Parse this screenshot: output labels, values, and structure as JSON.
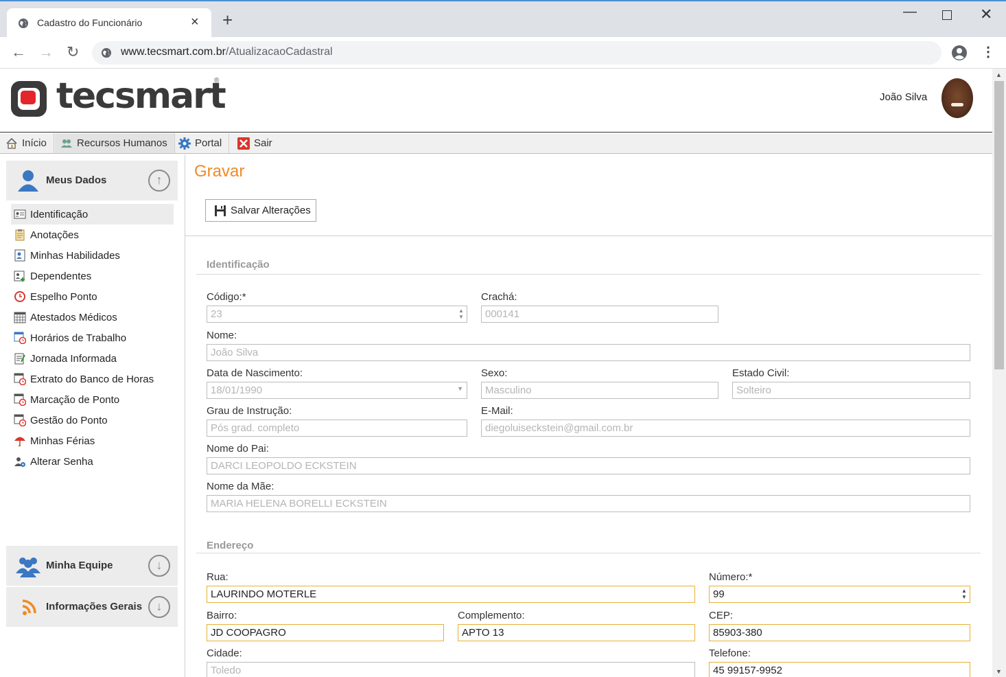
{
  "browser": {
    "tab_title": "Cadastro do Funcionário",
    "url_host": "www.tecsmart.com.br",
    "url_path": "/AtualizacaoCadastral"
  },
  "header": {
    "logo_text": "tecsmart",
    "logo_reg": "®",
    "user_name": "João Silva"
  },
  "menu": {
    "items": [
      {
        "label": "Início",
        "icon": "home-icon"
      },
      {
        "label": "Recursos Humanos",
        "icon": "people-icon"
      },
      {
        "label": "Portal",
        "icon": "gear-icon"
      },
      {
        "label": "Sair",
        "icon": "exit-icon"
      }
    ]
  },
  "sidebar": {
    "meus_dados": "Meus Dados",
    "items": [
      {
        "label": "Identificação"
      },
      {
        "label": "Anotações"
      },
      {
        "label": "Minhas Habilidades"
      },
      {
        "label": "Dependentes"
      },
      {
        "label": "Espelho Ponto"
      },
      {
        "label": "Atestados Médicos"
      },
      {
        "label": "Horários de Trabalho"
      },
      {
        "label": "Jornada Informada"
      },
      {
        "label": "Extrato do Banco de Horas"
      },
      {
        "label": "Marcação de Ponto"
      },
      {
        "label": "Gestão do Ponto"
      },
      {
        "label": "Minhas Férias"
      },
      {
        "label": "Alterar Senha"
      }
    ],
    "minha_equipe": "Minha Equipe",
    "informacoes_gerais": "Informações Gerais"
  },
  "content": {
    "title": "Gravar",
    "save_label": "Salvar Alterações",
    "identificacao": {
      "section": "Identificação",
      "codigo_label": "Código:*",
      "codigo_value": "23",
      "cracha_label": "Crachá:",
      "cracha_value": "000141",
      "nome_label": "Nome:",
      "nome_value": "João Silva",
      "nasc_label": "Data de Nascimento:",
      "nasc_value": "18/01/1990",
      "sexo_label": "Sexo:",
      "sexo_value": "Masculino",
      "civil_label": "Estado Civil:",
      "civil_value": "Solteiro",
      "grau_label": "Grau de Instrução:",
      "grau_value": "Pós grad. completo",
      "email_label": "E-Mail:",
      "email_value": "diegoluiseckstein@gmail.com.br",
      "pai_label": "Nome do Pai:",
      "pai_value": "DARCI LEOPOLDO ECKSTEIN",
      "mae_label": "Nome da Mãe:",
      "mae_value": "MARIA HELENA BORELLI ECKSTEIN"
    },
    "endereco": {
      "section": "Endereço",
      "rua_label": "Rua:",
      "rua_value": "LAURINDO MOTERLE",
      "numero_label": "Número:*",
      "numero_value": "99",
      "bairro_label": "Bairro:",
      "bairro_value": "JD COOPAGRO",
      "compl_label": "Complemento:",
      "compl_value": "APTO 13",
      "cep_label": "CEP:",
      "cep_value": "85903-380",
      "cidade_label": "Cidade:",
      "cidade_value": "Toledo",
      "tel_label": "Telefone:",
      "tel_value": "45 99157-9952"
    }
  },
  "colors": {
    "accent": "#f08a24",
    "editable_border": "#e8b034",
    "logo_red": "#e3262b"
  }
}
